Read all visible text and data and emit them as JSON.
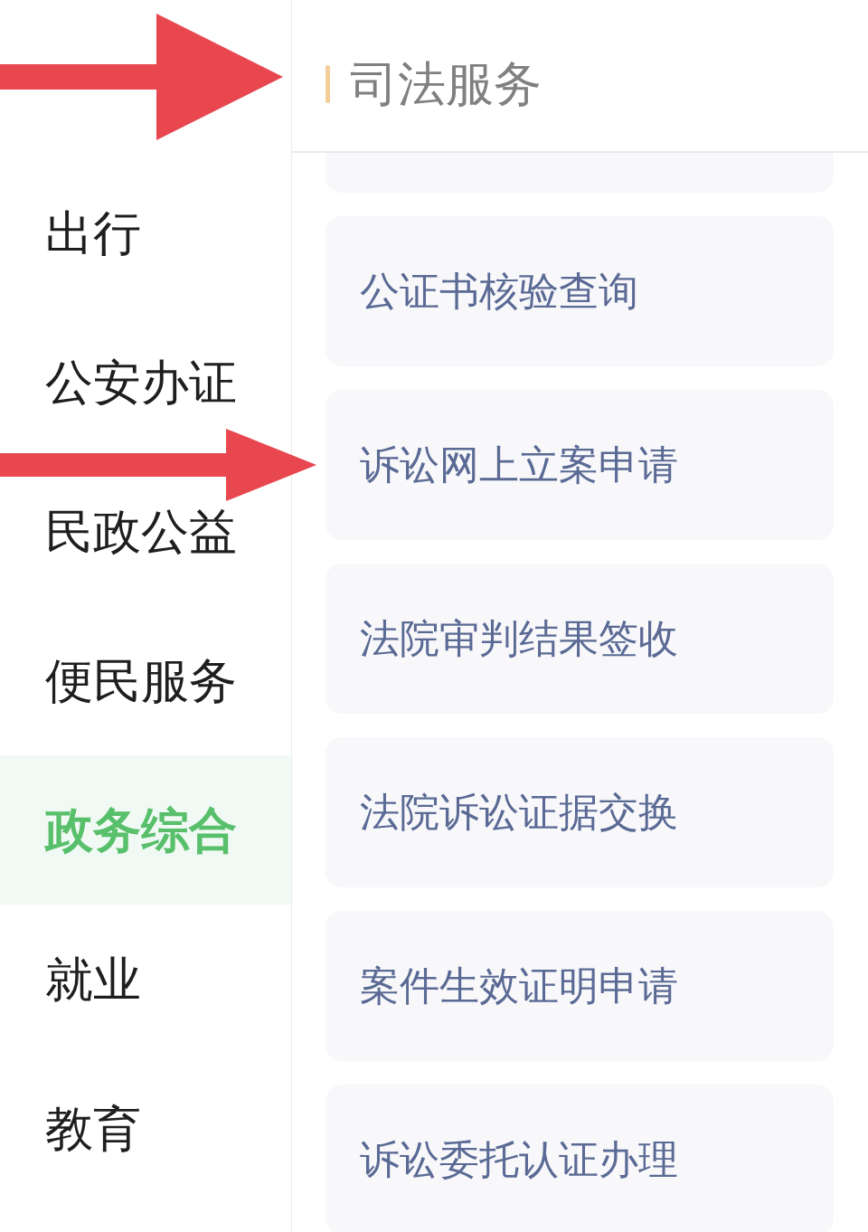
{
  "sidebar": {
    "items": [
      {
        "label": "出行",
        "selected": false
      },
      {
        "label": "公安办证",
        "selected": false
      },
      {
        "label": "民政公益",
        "selected": false
      },
      {
        "label": "便民服务",
        "selected": false
      },
      {
        "label": "政务综合",
        "selected": true
      },
      {
        "label": "就业",
        "selected": false
      },
      {
        "label": "教育",
        "selected": false
      }
    ]
  },
  "panel": {
    "title": "司法服务",
    "arrow": true,
    "services": [
      {
        "label": "公证书核验查询",
        "arrow": false
      },
      {
        "label": "诉讼网上立案申请",
        "arrow": true
      },
      {
        "label": "法院审判结果签收",
        "arrow": false
      },
      {
        "label": "法院诉讼证据交换",
        "arrow": false
      },
      {
        "label": "案件生效证明申请",
        "arrow": false
      },
      {
        "label": "诉讼委托认证办理",
        "arrow": false
      }
    ]
  }
}
